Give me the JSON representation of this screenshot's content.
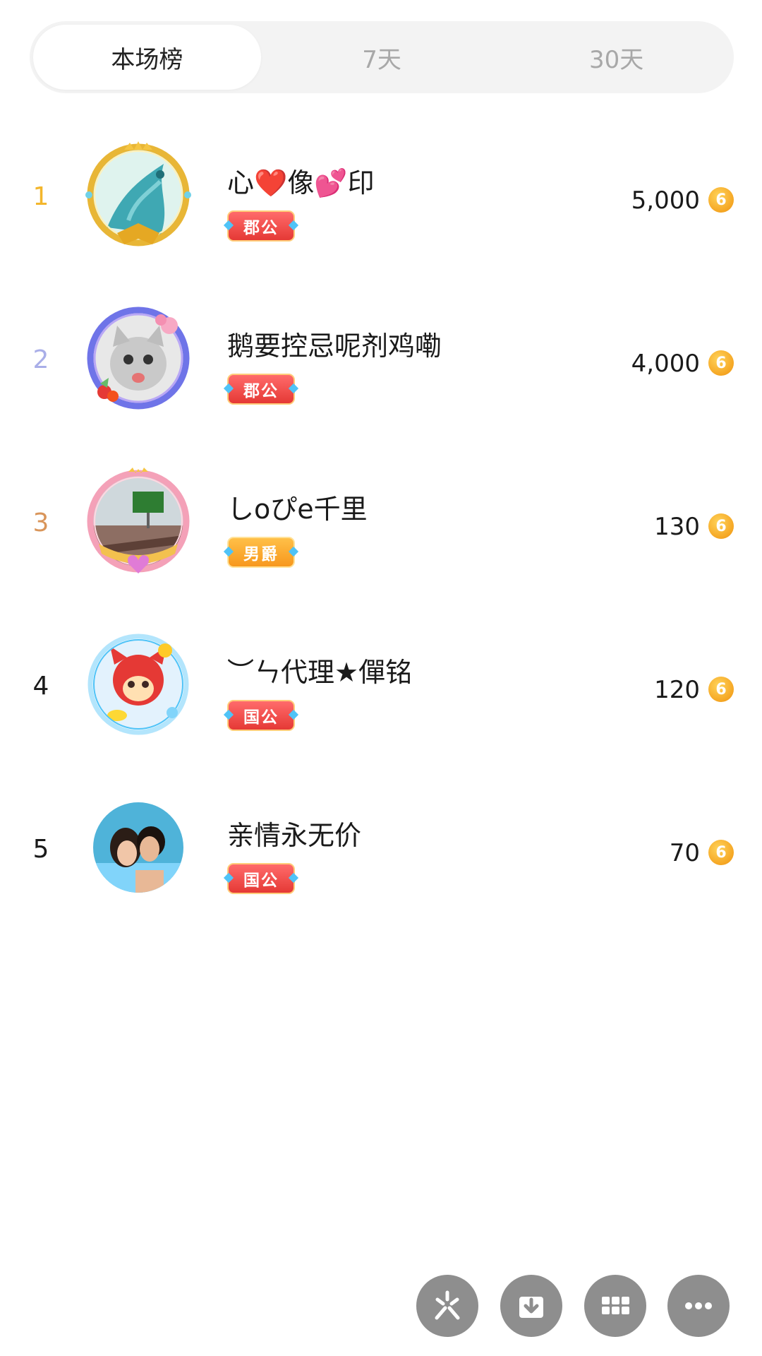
{
  "tabs": [
    {
      "label": "本场榜",
      "active": true
    },
    {
      "label": "7天",
      "active": false
    },
    {
      "label": "30天",
      "active": false
    }
  ],
  "ranking": [
    {
      "rank": "1",
      "rank_color": "#f3b62c",
      "name": "心❤️像💕印",
      "badge": "郡公",
      "badge_style": "red",
      "amount": "5,000"
    },
    {
      "rank": "2",
      "rank_color": "#a9aee8",
      "name": "鹅要控忌呢剂鸡嘞",
      "badge": "郡公",
      "badge_style": "red",
      "amount": "4,000"
    },
    {
      "rank": "3",
      "rank_color": "#d9955a",
      "name": "しoぴe千里",
      "badge": "男爵",
      "badge_style": "gold",
      "amount": "130"
    },
    {
      "rank": "4",
      "rank_color": "#1a1a1a",
      "name": "︶ㄣ代理★僤铭",
      "badge": "国公",
      "badge_style": "red",
      "amount": "120"
    },
    {
      "rank": "5",
      "rank_color": "#1a1a1a",
      "name": "亲情永无价",
      "badge": "国公",
      "badge_style": "red",
      "amount": "70"
    }
  ],
  "coin_symbol": "6",
  "icons": {
    "coin": "coin-icon",
    "fab_1": "pinwheel-icon",
    "fab_2": "download-icon",
    "fab_3": "grid-icon",
    "fab_4": "more-dots-icon"
  }
}
